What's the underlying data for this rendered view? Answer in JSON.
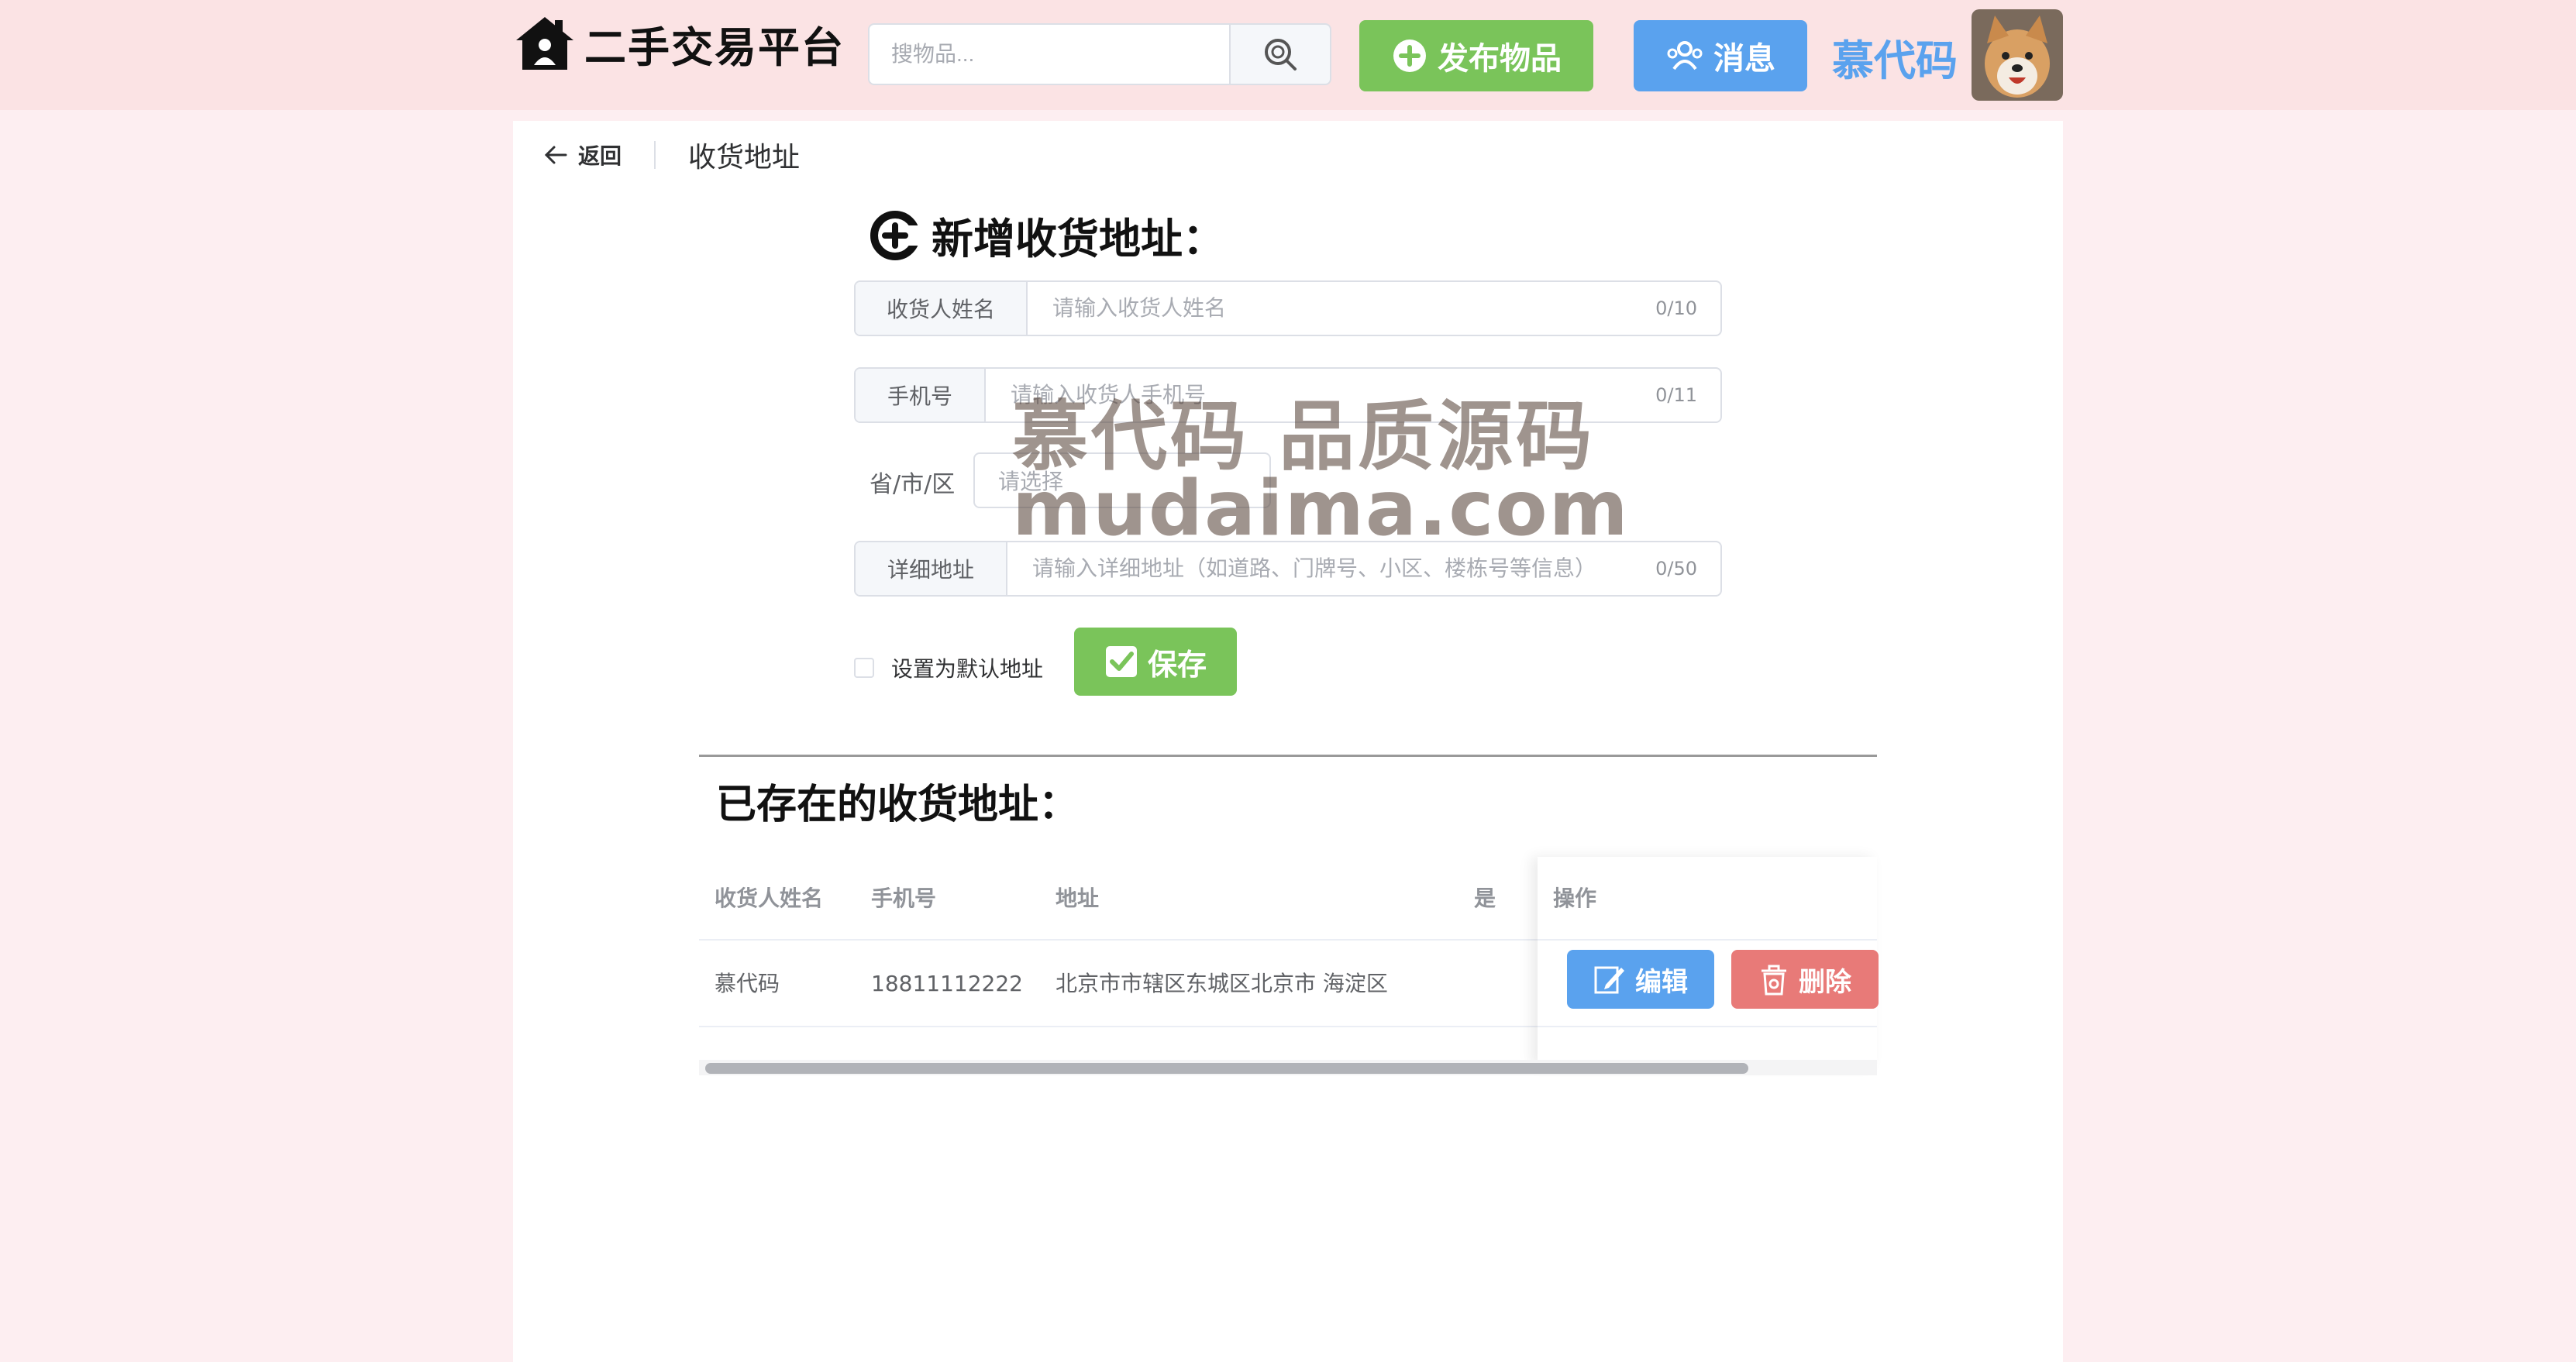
{
  "header": {
    "app_title": "二手交易平台",
    "search_placeholder": "搜物品...",
    "publish_label": "发布物品",
    "message_label": "消息",
    "username": "慕代码"
  },
  "breadcrumb": {
    "back_label": "返回",
    "page_title": "收货地址"
  },
  "form": {
    "title": "新增收货地址：",
    "name": {
      "label": "收货人姓名",
      "placeholder": "请输入收货人姓名",
      "counter": "0/10"
    },
    "phone": {
      "label": "手机号",
      "placeholder": "请输入收货人手机号",
      "counter": "0/11"
    },
    "region": {
      "label": "省/市/区",
      "placeholder": "请选择"
    },
    "detail": {
      "label": "详细地址",
      "placeholder": "请输入详细地址（如道路、门牌号、小区、楼栋号等信息）",
      "counter": "0/50"
    },
    "default_label": "设置为默认地址",
    "save_label": "保存"
  },
  "address_list": {
    "title": "已存在的收货地址：",
    "columns": [
      "收货人姓名",
      "手机号",
      "地址",
      "是",
      "操作"
    ],
    "rows": [
      {
        "name": "慕代码",
        "phone": "18811112222",
        "address": "北京市市辖区东城区北京市 海淀区"
      }
    ],
    "edit_label": "编辑",
    "delete_label": "删除"
  },
  "watermark": {
    "line1": "慕代码 品质源码",
    "line2": "mudaima.com"
  },
  "colors": {
    "header_bg": "#fbe3e4",
    "page_bg": "#fdeef1",
    "green": "#7ac45a",
    "blue": "#5aa2ee",
    "red": "#e87a78"
  }
}
